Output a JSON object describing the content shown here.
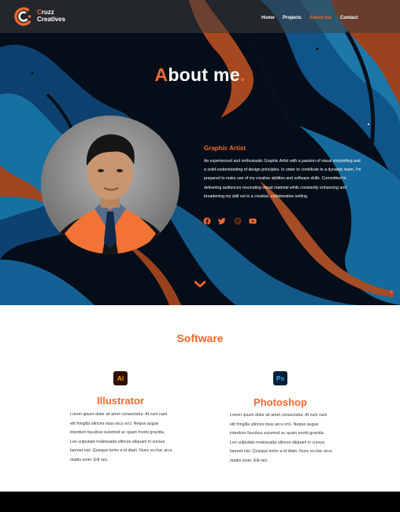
{
  "brand": {
    "line1": "Cruzz",
    "line2": "Creatives"
  },
  "nav": {
    "home": "Home",
    "projects": "Projects",
    "about": "About me",
    "contact": "Contact"
  },
  "hero": {
    "title_first": "A",
    "title_rest": "bout me",
    "title_dot": ".",
    "role": "Graphic Artist",
    "bio": "An experienced and enthusiastic Graphic Artist with a passion of visual storytelling and a solid understanding of design principles. In order to contribute to a dynamic team, I'm prepared to make use of my creative abilities and software skills. Committed to delivering audiences resonating visual material while constantly enhancing and broadening my skill set in a creative, collaborative setting.",
    "social_icons": [
      "facebook-icon",
      "twitter-icon",
      "pinterest-icon",
      "youtube-icon"
    ]
  },
  "software": {
    "title": "Software",
    "items": [
      {
        "icon_text": "Ai",
        "name": "Illustrator",
        "desc": "Lorem ipsum dolor sit amet consectetur. At cum nam elit fringilla ultrices risus arcu orci. Neque augue interdum faucibus euismod ac quam morbi gravida. Leo vulputate malesuada ultrices aliquam in cursus laoreet nisl. Quisque tortor a id diam. Nunc eu hac arcu mattis enim. Elit nec."
      },
      {
        "icon_text": "Ps",
        "name": "Photoshop",
        "desc": "Lorem ipsum dolor sit amet consectetur. At cum nam elit fringilla ultrices risus arcu orci. Neque augue interdum faucibus euismod ac quam morbi gravida. Leo vulputate malesuada ultrices aliquam in cursus laoreet nisl. Quisque tortor a id diam. Nunc eu hac arcu mattis enim. Elit nec."
      }
    ]
  },
  "colors": {
    "accent": "#f26a2e",
    "hero_dark": "#07101f",
    "hero_blue": "#1c8fd1",
    "footer": "#000000"
  }
}
